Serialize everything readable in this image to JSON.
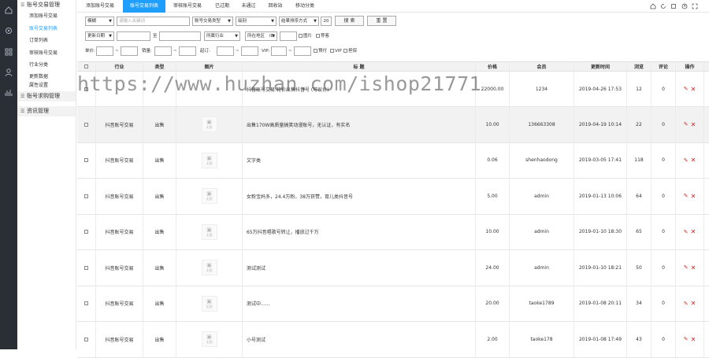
{
  "rail": {
    "icons": [
      "home-icon",
      "gear-icon",
      "grid-icon",
      "user-icon",
      "chart-icon"
    ]
  },
  "sidebar": {
    "groups": [
      {
        "label": "账号交易管理",
        "items": [
          "添加账号交易",
          "账号交易列表",
          "订单列表",
          "审核账号交易",
          "行业分类",
          "更新数据",
          "属性设置"
        ]
      },
      {
        "label": "账号求购管理",
        "items": []
      },
      {
        "label": "资讯管理",
        "items": []
      }
    ],
    "active_item": "账号交易列表"
  },
  "tabs": [
    "添加账号交易",
    "账号交易列表",
    "审核账号交易",
    "已过期",
    "未通过",
    "回收站",
    "移动分类"
  ],
  "top_icons": [
    "home-icon",
    "refresh-icon",
    "fullscreen-icon",
    "help-icon",
    "expand-icon"
  ],
  "filters": {
    "row1": {
      "field": "模糊",
      "keyword_placeholder": "请输入关键词",
      "type": "账号交易类型",
      "level": "级别",
      "sort": "结果排序方式",
      "pagesize": "20",
      "search": "搜 索",
      "reset": "重 置"
    },
    "row2": {
      "date_type": "更新日期",
      "to": "至",
      "industry": "所属行业",
      "region": "所在地区",
      "id_label": "ID:",
      "pic_label": "图片",
      "recommend_label": "荐客"
    },
    "row3": {
      "price_label": "单价:",
      "price_to": "~",
      "sales_label": "销量:",
      "sales_to": "~",
      "stock_label": "起订:",
      "stock_to": "~",
      "vip_label": "VIP:",
      "vip_to": "~",
      "bids_label": "预付",
      "vip_chk": "VIP",
      "cert_label": "担保"
    }
  },
  "table": {
    "headers": [
      "",
      "行业",
      "类型",
      "图片",
      "标 题",
      "价格",
      "会员",
      "更新时间",
      "浏览",
      "评论",
      "操作"
    ],
    "img_placeholder": "无图",
    "rows": [
      {
        "industry": "",
        "type": "",
        "title": "抖音账号交易 特价出售抖音号 (可议价)",
        "price": "22000.00",
        "member": "1234",
        "time": "2019-04-26 17:53",
        "views": "12",
        "comments": "0"
      },
      {
        "industry": "抖音账号交易",
        "type": "出售",
        "title": "出售170W高质量搞笑动漫账号，无认证，有实名",
        "price": "10.00",
        "member": "136663308",
        "time": "2019-04-19 10:14",
        "views": "22",
        "comments": "0"
      },
      {
        "industry": "抖音账号交易",
        "type": "出售",
        "title": "文字类",
        "price": "0.06",
        "member": "shenhaodong",
        "time": "2019-03-05 17:41",
        "views": "118",
        "comments": "0"
      },
      {
        "industry": "抖音账号交易",
        "type": "出售",
        "title": "女粉宝妈多，24.4万粉，38万获赞，育儿类抖音号",
        "price": "5.00",
        "member": "admin",
        "time": "2019-01-13 10:06",
        "views": "64",
        "comments": "0"
      },
      {
        "industry": "抖音账号交易",
        "type": "出售",
        "title": "65万抖音唱歌号转让，播放过千万",
        "price": "10.00",
        "member": "admin",
        "time": "2019-01-10 18:30",
        "views": "65",
        "comments": "0"
      },
      {
        "industry": "抖音账号交易",
        "type": "出售",
        "title": "测试测试",
        "price": "24.00",
        "member": "admin",
        "time": "2019-01-10 18:21",
        "views": "50",
        "comments": "0"
      },
      {
        "industry": "抖音账号交易",
        "type": "出售",
        "title": "测试中......",
        "price": "20.00",
        "member": "taoke1789",
        "time": "2019-01-08 20:11",
        "views": "34",
        "comments": "0"
      },
      {
        "industry": "抖音账号交易",
        "type": "出售",
        "title": "小号测试",
        "price": "2.00",
        "member": "taoke178",
        "time": "2019-01-08 17:49",
        "views": "43",
        "comments": "0"
      }
    ]
  },
  "watermark": "https://www.huzhan.com/ishop21771"
}
